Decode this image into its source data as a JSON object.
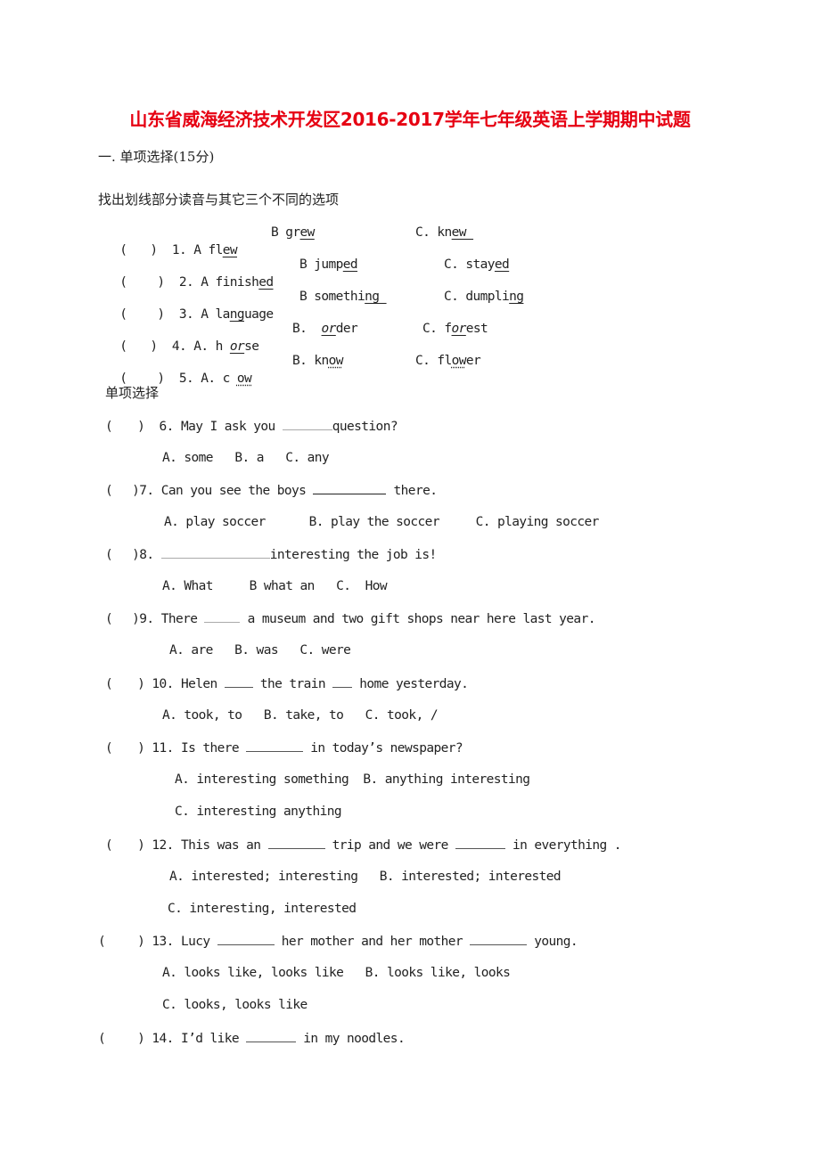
{
  "title": "山东省威海经济技术开发区2016-2017学年七年级英语上学期期中试题",
  "section1": {
    "heading": "一. 单项选择(15分)",
    "phonetics_instruction": "找出划线部分读音与其它三个不同的选项",
    "phonetics": [
      {
        "num": "1. ",
        "a_pre": "A fl",
        "a_u": "ew",
        "a_post": "",
        "b_pre": "B gr",
        "b_u": "ew",
        "b_post": "",
        "c_pre": "C. kn",
        "c_u": "ew ",
        "c_post": ""
      },
      {
        "num": "2. ",
        "a_pre": "A finish",
        "a_u": "ed",
        "a_post": "",
        "b_pre": "B jump",
        "b_u": "ed",
        "b_post": "",
        "c_pre": "C. stay",
        "c_u": "ed",
        "c_post": ""
      },
      {
        "num": "3. ",
        "a_pre": "A la",
        "a_u": "ng",
        "a_post": "uage",
        "b_pre": "B somethi",
        "b_u": "ng ",
        "b_post": "",
        "c_pre": "C. dumpli",
        "c_u": "ng",
        "c_post": ""
      },
      {
        "num": "4. ",
        "a_pre": "A. h",
        "a_u": "or",
        "a_post": "se",
        "b_pre": "B. ",
        "b_u": "or",
        "b_post": "der",
        "c_pre": "C. f",
        "c_u": "or",
        "c_post": "est"
      },
      {
        "num": "5. ",
        "a_pre": "A. c",
        "a_u": "ow",
        "a_post": "",
        "b_pre": "B. kn",
        "b_u": "ow",
        "b_post": "",
        "c_pre": "C. fl",
        "c_u": "ow",
        "c_post": "er"
      }
    ],
    "mc_heading": "单项选择",
    "questions": [
      {
        "num": "6.",
        "pre": "May I ask you ",
        "mid": "question?",
        "options": [
          "A. some",
          "B. a",
          "C. any"
        ]
      },
      {
        "num": "7.",
        "pre": "Can you see the boys ",
        "mid": " there.",
        "options": [
          "A. play soccer",
          "B. play the soccer",
          "C. playing soccer"
        ]
      },
      {
        "num": "8.",
        "pre": "",
        "mid": "interesting the job is!",
        "options": [
          "A. What",
          "B what an",
          "C.  How"
        ]
      },
      {
        "num": "9.",
        "pre": "There ",
        "mid": " a museum and two gift shops near here last year.",
        "options": [
          "A. are",
          "B. was",
          "C. were"
        ]
      },
      {
        "num": "10.",
        "pre": "Helen ",
        "mid": " the train ",
        "post": " home yesterday.",
        "options": [
          "A. took, to",
          "B. take, to",
          "C. took, /"
        ]
      },
      {
        "num": "11.",
        "pre": "Is there ",
        "mid": " in today’s newspaper?",
        "options": [
          "A. interesting something",
          "B. anything interesting",
          "C. interesting anything"
        ]
      },
      {
        "num": "12.",
        "pre": "This was an ",
        "mid": " trip and we were ",
        "post": " in everything .",
        "options": [
          "A. interested; interesting",
          "B. interested; interested",
          "C. interesting, interested"
        ]
      },
      {
        "num": "13.",
        "pre": "Lucy ",
        "mid": " her mother and her mother ",
        "post": " young.",
        "options": [
          "A. looks like, looks like",
          "B. looks like, looks",
          "C. looks, looks like"
        ]
      },
      {
        "num": "14.",
        "pre": "I’d like ",
        "mid": " in my noodles."
      }
    ]
  },
  "paren_open": "(",
  "paren_close": ")"
}
